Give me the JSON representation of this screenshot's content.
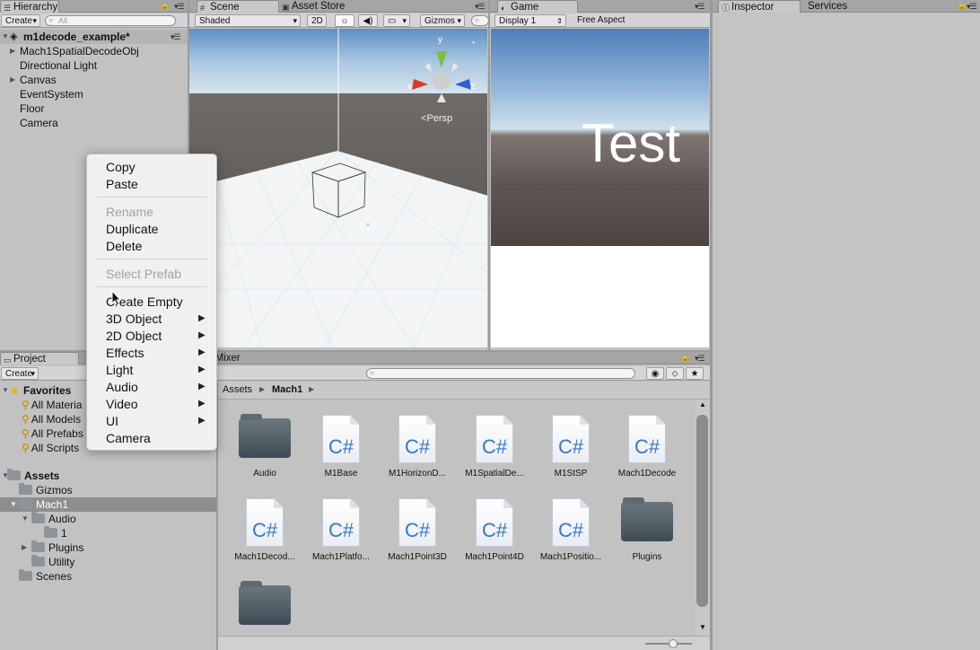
{
  "hierarchy": {
    "tab": "Hierarchy",
    "create": "Create",
    "search_placeholder": "All",
    "scene": "m1decode_example*",
    "items": [
      "Mach1SpatialDecodeObj",
      "Directional Light",
      "Canvas",
      "EventSystem",
      "Floor",
      "Camera"
    ]
  },
  "scene": {
    "tabs": [
      "Scene",
      "Asset Store"
    ],
    "shading": "Shaded",
    "mode_2d": "2D",
    "gizmos": "Gizmos",
    "persp": "Persp",
    "axis_y": "y",
    "axis_x": "x",
    "axis_z": "z"
  },
  "game": {
    "tab": "Game",
    "display": "Display 1",
    "aspect": "Free Aspect",
    "text": "Test"
  },
  "inspector": {
    "tabs": [
      "Inspector",
      "Services"
    ]
  },
  "project": {
    "tab": "Project",
    "mixer_tab": "o Mixer",
    "create": "Create",
    "favorites": {
      "label": "Favorites",
      "items": [
        "All Materia",
        "All Models",
        "All Prefabs",
        "All Scripts"
      ]
    },
    "tree": {
      "assets": "Assets",
      "gizmos": "Gizmos",
      "mach1": "Mach1",
      "audio": "Audio",
      "one": "1",
      "plugins": "Plugins",
      "utility": "Utility",
      "scenes": "Scenes"
    },
    "breadcrumb": [
      "Assets",
      "Mach1"
    ],
    "assets": [
      {
        "label": "Audio",
        "type": "folder"
      },
      {
        "label": "M1Base",
        "type": "cs"
      },
      {
        "label": "M1HorizonD...",
        "type": "cs"
      },
      {
        "label": "M1SpatialDe...",
        "type": "cs"
      },
      {
        "label": "M1StSP",
        "type": "cs"
      },
      {
        "label": "Mach1Decode",
        "type": "cs"
      },
      {
        "label": "Mach1Decod...",
        "type": "cs"
      },
      {
        "label": "Mach1Platfo...",
        "type": "cs"
      },
      {
        "label": "Mach1Point3D",
        "type": "cs"
      },
      {
        "label": "Mach1Point4D",
        "type": "cs"
      },
      {
        "label": "Mach1Positio...",
        "type": "cs"
      },
      {
        "label": "Plugins",
        "type": "folder"
      },
      {
        "label": "",
        "type": "folder"
      }
    ],
    "cs_glyph": "C#"
  },
  "context_menu": {
    "copy": "Copy",
    "paste": "Paste",
    "rename": "Rename",
    "duplicate": "Duplicate",
    "delete": "Delete",
    "select_prefab": "Select Prefab",
    "create_empty": "Create Empty",
    "obj3d": "3D Object",
    "obj2d": "2D Object",
    "effects": "Effects",
    "light": "Light",
    "audio": "Audio",
    "video": "Video",
    "ui": "UI",
    "camera": "Camera"
  },
  "colors": {
    "selection": "#8e8e8e",
    "cs_blue": "#3a77c3",
    "axis_green": "#7ac142",
    "axis_red": "#d8382e",
    "axis_blue": "#2f5fd6"
  }
}
